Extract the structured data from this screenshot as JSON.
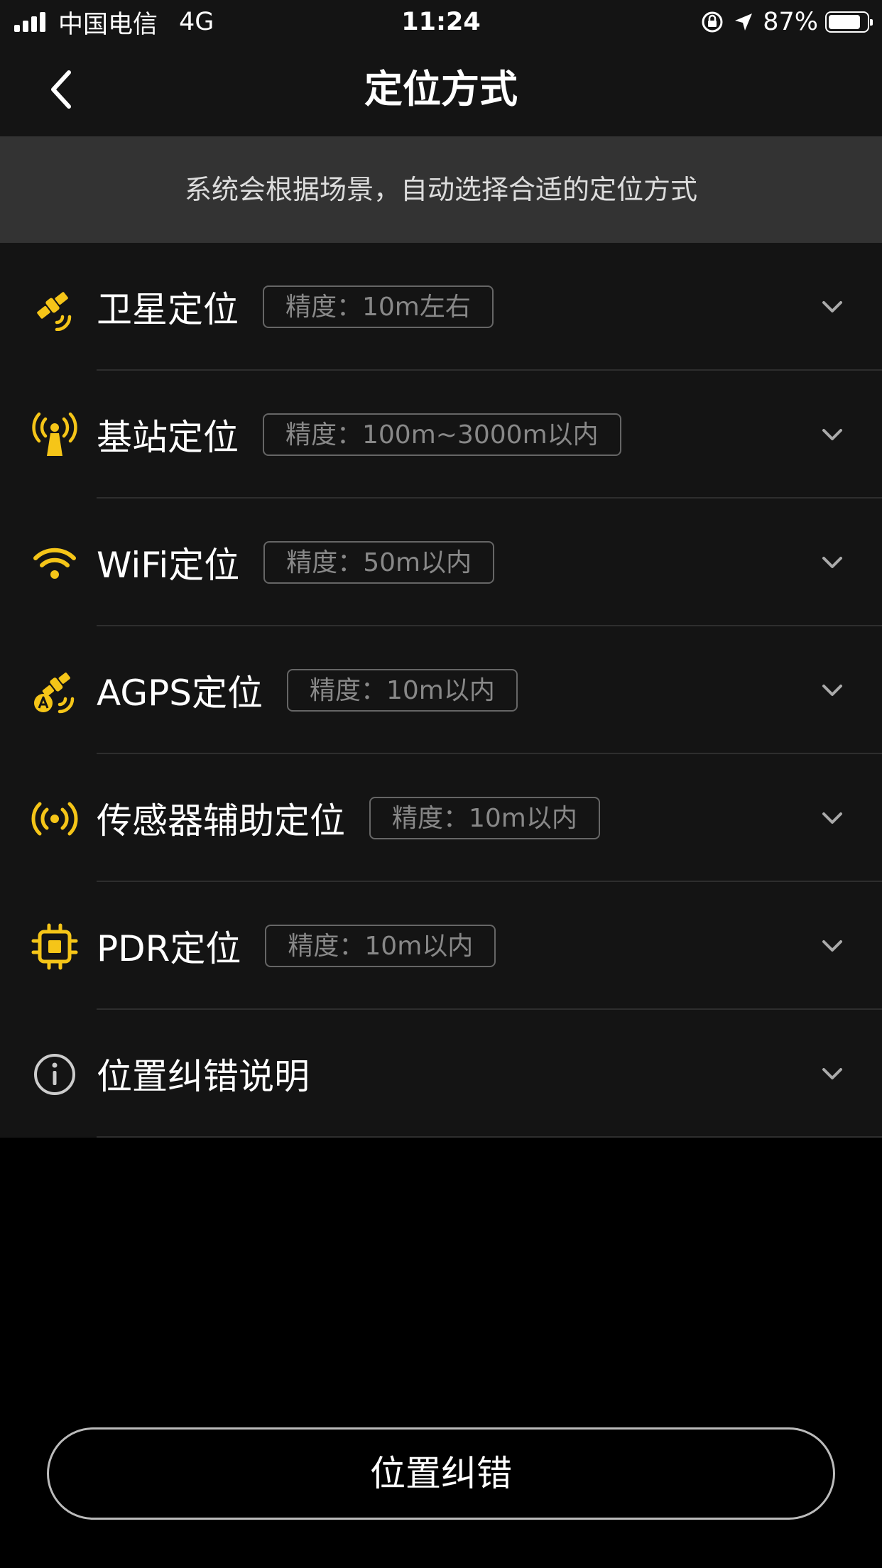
{
  "status_bar": {
    "carrier": "中国电信",
    "network": "4G",
    "time": "11:24",
    "battery": "87%",
    "battery_level": 0.87
  },
  "header": {
    "title": "定位方式",
    "back_icon": "chevron-left-icon"
  },
  "banner": {
    "text": "系统会根据场景，自动选择合适的定位方式"
  },
  "methods": [
    {
      "name": "卫星定位",
      "precision": "精度：10m左右",
      "icon": "satellite-icon"
    },
    {
      "name": "基站定位",
      "precision": "精度：100m~3000m以内",
      "icon": "cell-tower-icon"
    },
    {
      "name": "WiFi定位",
      "precision": "精度：50m以内",
      "icon": "wifi-icon"
    },
    {
      "name": "AGPS定位",
      "precision": "精度：10m以内",
      "icon": "agps-satellite-icon"
    },
    {
      "name": "传感器辅助定位",
      "precision": "精度：10m以内",
      "icon": "sensor-icon"
    },
    {
      "name": "PDR定位",
      "precision": "精度：10m以内",
      "icon": "chip-icon"
    },
    {
      "name": "位置纠错说明",
      "icon": "info-icon"
    }
  ],
  "bottom_button": {
    "label": "位置纠错"
  },
  "colors": {
    "accent": "#F5C518",
    "background": "#000000",
    "surface": "#141414",
    "banner": "#333333"
  }
}
